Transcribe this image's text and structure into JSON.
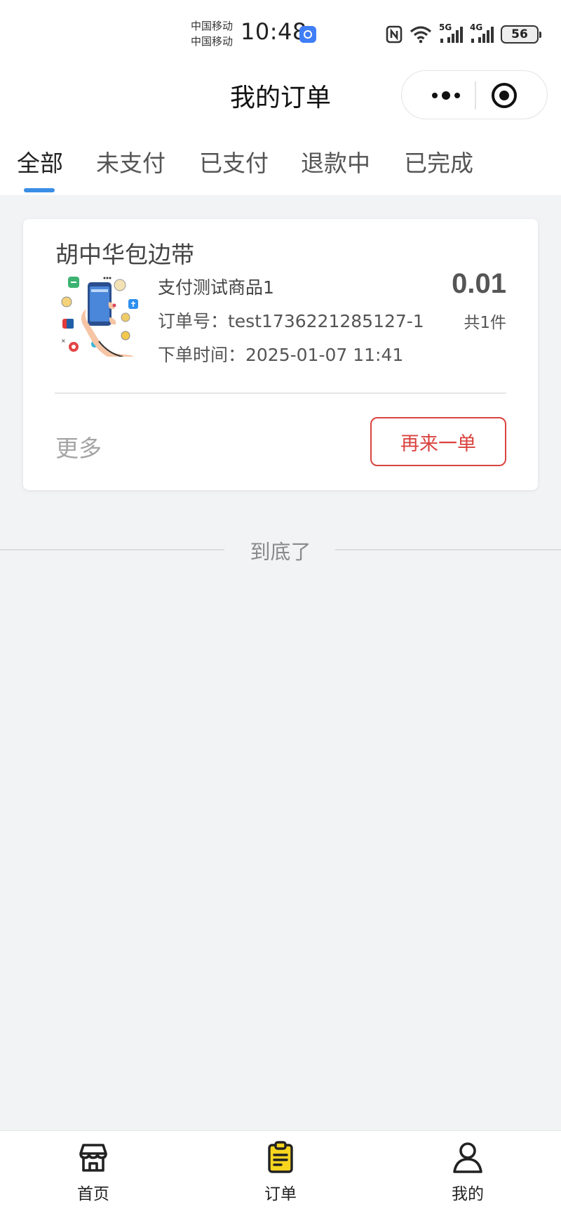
{
  "status_bar": {
    "carrier_1": "中国移动",
    "carrier_2": "中国移动",
    "time": "10:48",
    "network_1": "5G",
    "network_2": "4G",
    "battery": "56"
  },
  "nav": {
    "title": "我的订单"
  },
  "tabs": [
    {
      "label": "全部",
      "active": true
    },
    {
      "label": "未支付",
      "active": false
    },
    {
      "label": "已支付",
      "active": false
    },
    {
      "label": "退款中",
      "active": false
    },
    {
      "label": "已完成",
      "active": false
    }
  ],
  "order": {
    "shop_name": "胡中华包边带",
    "product_name": "支付测试商品1",
    "order_no": "订单号：test1736221285127-1",
    "order_time": "下单时间：2025-01-07 11:41",
    "price": "0.01",
    "quantity": "共1件",
    "more_label": "更多",
    "reorder_label": "再来一单"
  },
  "end_text": "到底了",
  "tabbar": [
    {
      "label": "首页",
      "icon": "store-icon"
    },
    {
      "label": "订单",
      "icon": "clipboard-icon"
    },
    {
      "label": "我的",
      "icon": "user-icon"
    }
  ],
  "colors": {
    "accent": "#3a8ee6",
    "reorder": "#d9433f",
    "order_icon": "#f7d51f",
    "background": "#f2f3f5"
  }
}
